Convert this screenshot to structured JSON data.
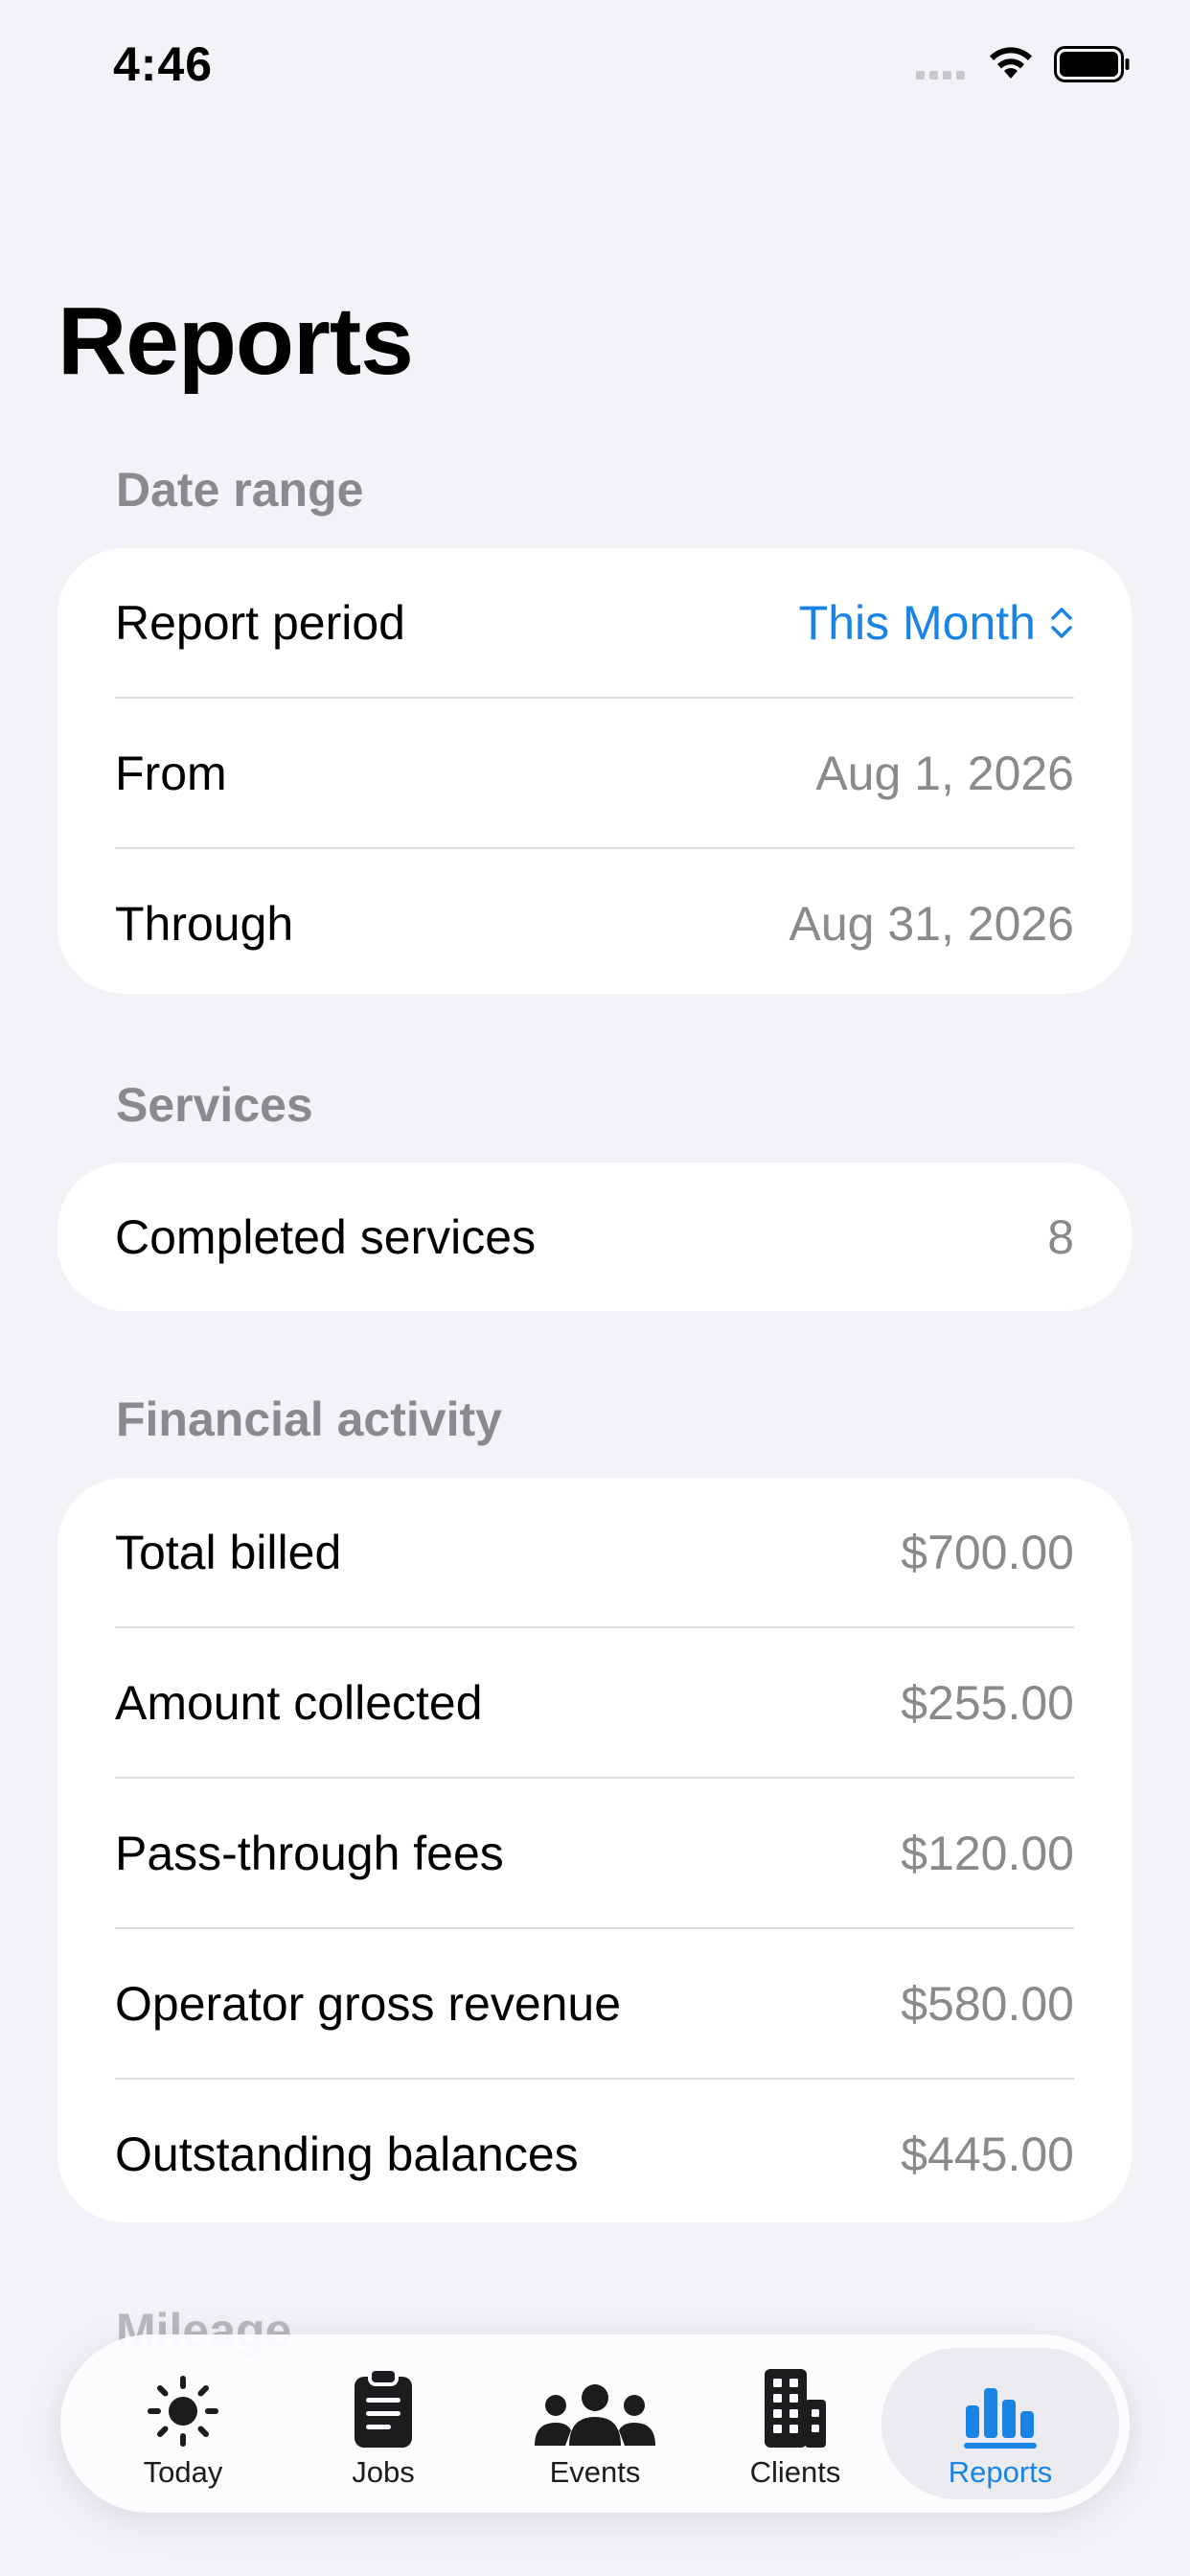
{
  "status_bar": {
    "time": "4:46"
  },
  "title": "Reports",
  "sections": {
    "date_range": {
      "header": "Date range",
      "report_period_label": "Report period",
      "report_period_value": "This Month",
      "from_label": "From",
      "from_value": "Aug 1, 2026",
      "through_label": "Through",
      "through_value": "Aug 31, 2026"
    },
    "services": {
      "header": "Services",
      "completed_label": "Completed services",
      "completed_value": "8"
    },
    "financial": {
      "header": "Financial activity",
      "rows": [
        {
          "label": "Total billed",
          "value": "$700.00"
        },
        {
          "label": "Amount collected",
          "value": "$255.00"
        },
        {
          "label": "Pass-through fees",
          "value": "$120.00"
        },
        {
          "label": "Operator gross revenue",
          "value": "$580.00"
        },
        {
          "label": "Outstanding balances",
          "value": "$445.00"
        }
      ]
    },
    "mileage": {
      "header": "Mileage"
    }
  },
  "tabbar": {
    "accent": "#1a84e6",
    "items": [
      {
        "label": "Today",
        "icon": "sun-icon"
      },
      {
        "label": "Jobs",
        "icon": "clipboard-icon"
      },
      {
        "label": "Events",
        "icon": "people-icon"
      },
      {
        "label": "Clients",
        "icon": "building-icon"
      },
      {
        "label": "Reports",
        "icon": "bar-chart-icon",
        "selected": true
      }
    ]
  }
}
